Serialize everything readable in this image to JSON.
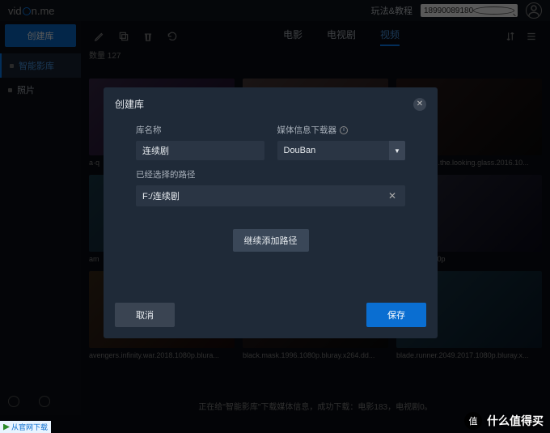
{
  "header": {
    "logo_left": "vid",
    "logo_right": "n.me",
    "tips_link": "玩法&教程",
    "search_value": "18990089180",
    "avatar_glyph": "👤"
  },
  "sidebar": {
    "create_btn": "创建库",
    "items": [
      {
        "label": "智能影库",
        "active": true
      },
      {
        "label": "照片",
        "active": false
      }
    ]
  },
  "tabs": {
    "items": [
      "电影",
      "电视剧",
      "视频"
    ],
    "active_index": 2,
    "count_label": "数量",
    "count_value": "127"
  },
  "grid": [
    {
      "name": "a·q",
      "t": "t1"
    },
    {
      "name": "",
      "t": "t2"
    },
    {
      "name": "alice.through.the.looking.glass.2016.10...",
      "t": "t3"
    },
    {
      "name": "am",
      "t": "t4"
    },
    {
      "name": "",
      "t": "t5"
    },
    {
      "name": "ntended-1080p",
      "t": "t6"
    },
    {
      "name": "avengers.infinity.war.2018.1080p.blura...",
      "t": "t7"
    },
    {
      "name": "black.mask.1996.1080p.bluray.x264.dd...",
      "t": "t3"
    },
    {
      "name": "blade.runner.2049.2017.1080p.bluray.x...",
      "t": "t4"
    }
  ],
  "dialog": {
    "title": "创建库",
    "name_label": "库名称",
    "name_value": "连续剧",
    "downloader_label": "媒体信息下载器",
    "downloader_value": "DouBan",
    "paths_label": "已经选择的路径",
    "path_value": "F:/连续剧",
    "add_path_btn": "继续添加路径",
    "cancel": "取消",
    "save": "保存"
  },
  "status": "正在给\"智能影库\"下载媒体信息，成功下载：电影183，电视剧0。",
  "footer": {
    "bl_text": "从官网下载",
    "badge_glyph": "值",
    "badge_text": "什么值得买"
  }
}
